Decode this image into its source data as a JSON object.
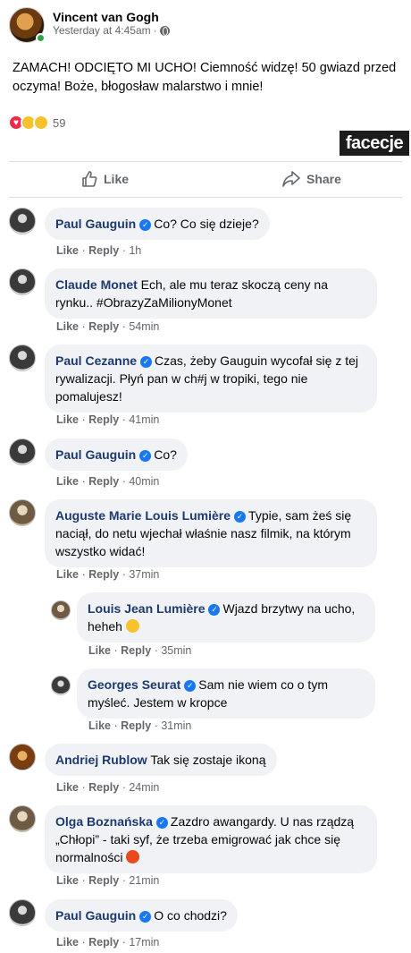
{
  "post": {
    "author": "Vincent van Gogh",
    "meta_time": "Yesterday at 4:45am",
    "meta_sep": "·",
    "text": "ZAMACH! ODCIĘTO MI UCHO! Ciemność widzę! 50 gwiazd przed oczyma! Boże, błogosław malarstwo i mnie!",
    "reaction_count": "59",
    "watermark": "facecje"
  },
  "actions": {
    "like": "Like",
    "share": "Share"
  },
  "comment_actions": {
    "like": "Like",
    "reply": "Reply",
    "dot": "·"
  },
  "comments": [
    {
      "name": "Paul Gauguin",
      "text": "Co? Co się dzieje?",
      "time": "1h"
    },
    {
      "name": "Claude Monet",
      "text": "Ech, ale mu teraz skoczą ceny na rynku.. #ObrazyZaMilionyMonet",
      "time": "54min"
    },
    {
      "name": "Paul Cezanne",
      "text": "Czas, żeby Gauguin wycofał się z tej rywalizacji. Płyń pan w ch#j w tropiki, tego nie pomalujesz!",
      "time": "41min"
    },
    {
      "name": "Paul Gauguin",
      "text": "Co?",
      "time": "40min"
    },
    {
      "name": "Auguste Marie Louis Lumière",
      "text": "Typie, sam żeś się naciął, do netu wjechał właśnie nasz filmik, na którym wszystko widać!",
      "time": "37min"
    },
    {
      "name": "Louis Jean Lumière",
      "text": "Wjazd brzytwy na ucho, heheh",
      "time": "35min"
    },
    {
      "name": "Georges Seurat",
      "text": "Sam nie wiem co o tym myśleć. Jestem w kropce",
      "time": "31min"
    },
    {
      "name": "Andriej Rublow",
      "text": "Tak się zostaje ikoną",
      "time": "24min"
    },
    {
      "name": "Olga Boznańska",
      "text": "Zazdro awangardy. U nas rządzą „Chłopi” - taki syf, że trzeba emigrować jak chce się normalności",
      "time": "21min"
    },
    {
      "name": "Paul Gauguin",
      "text": "O co chodzi?",
      "time": "17min"
    }
  ]
}
